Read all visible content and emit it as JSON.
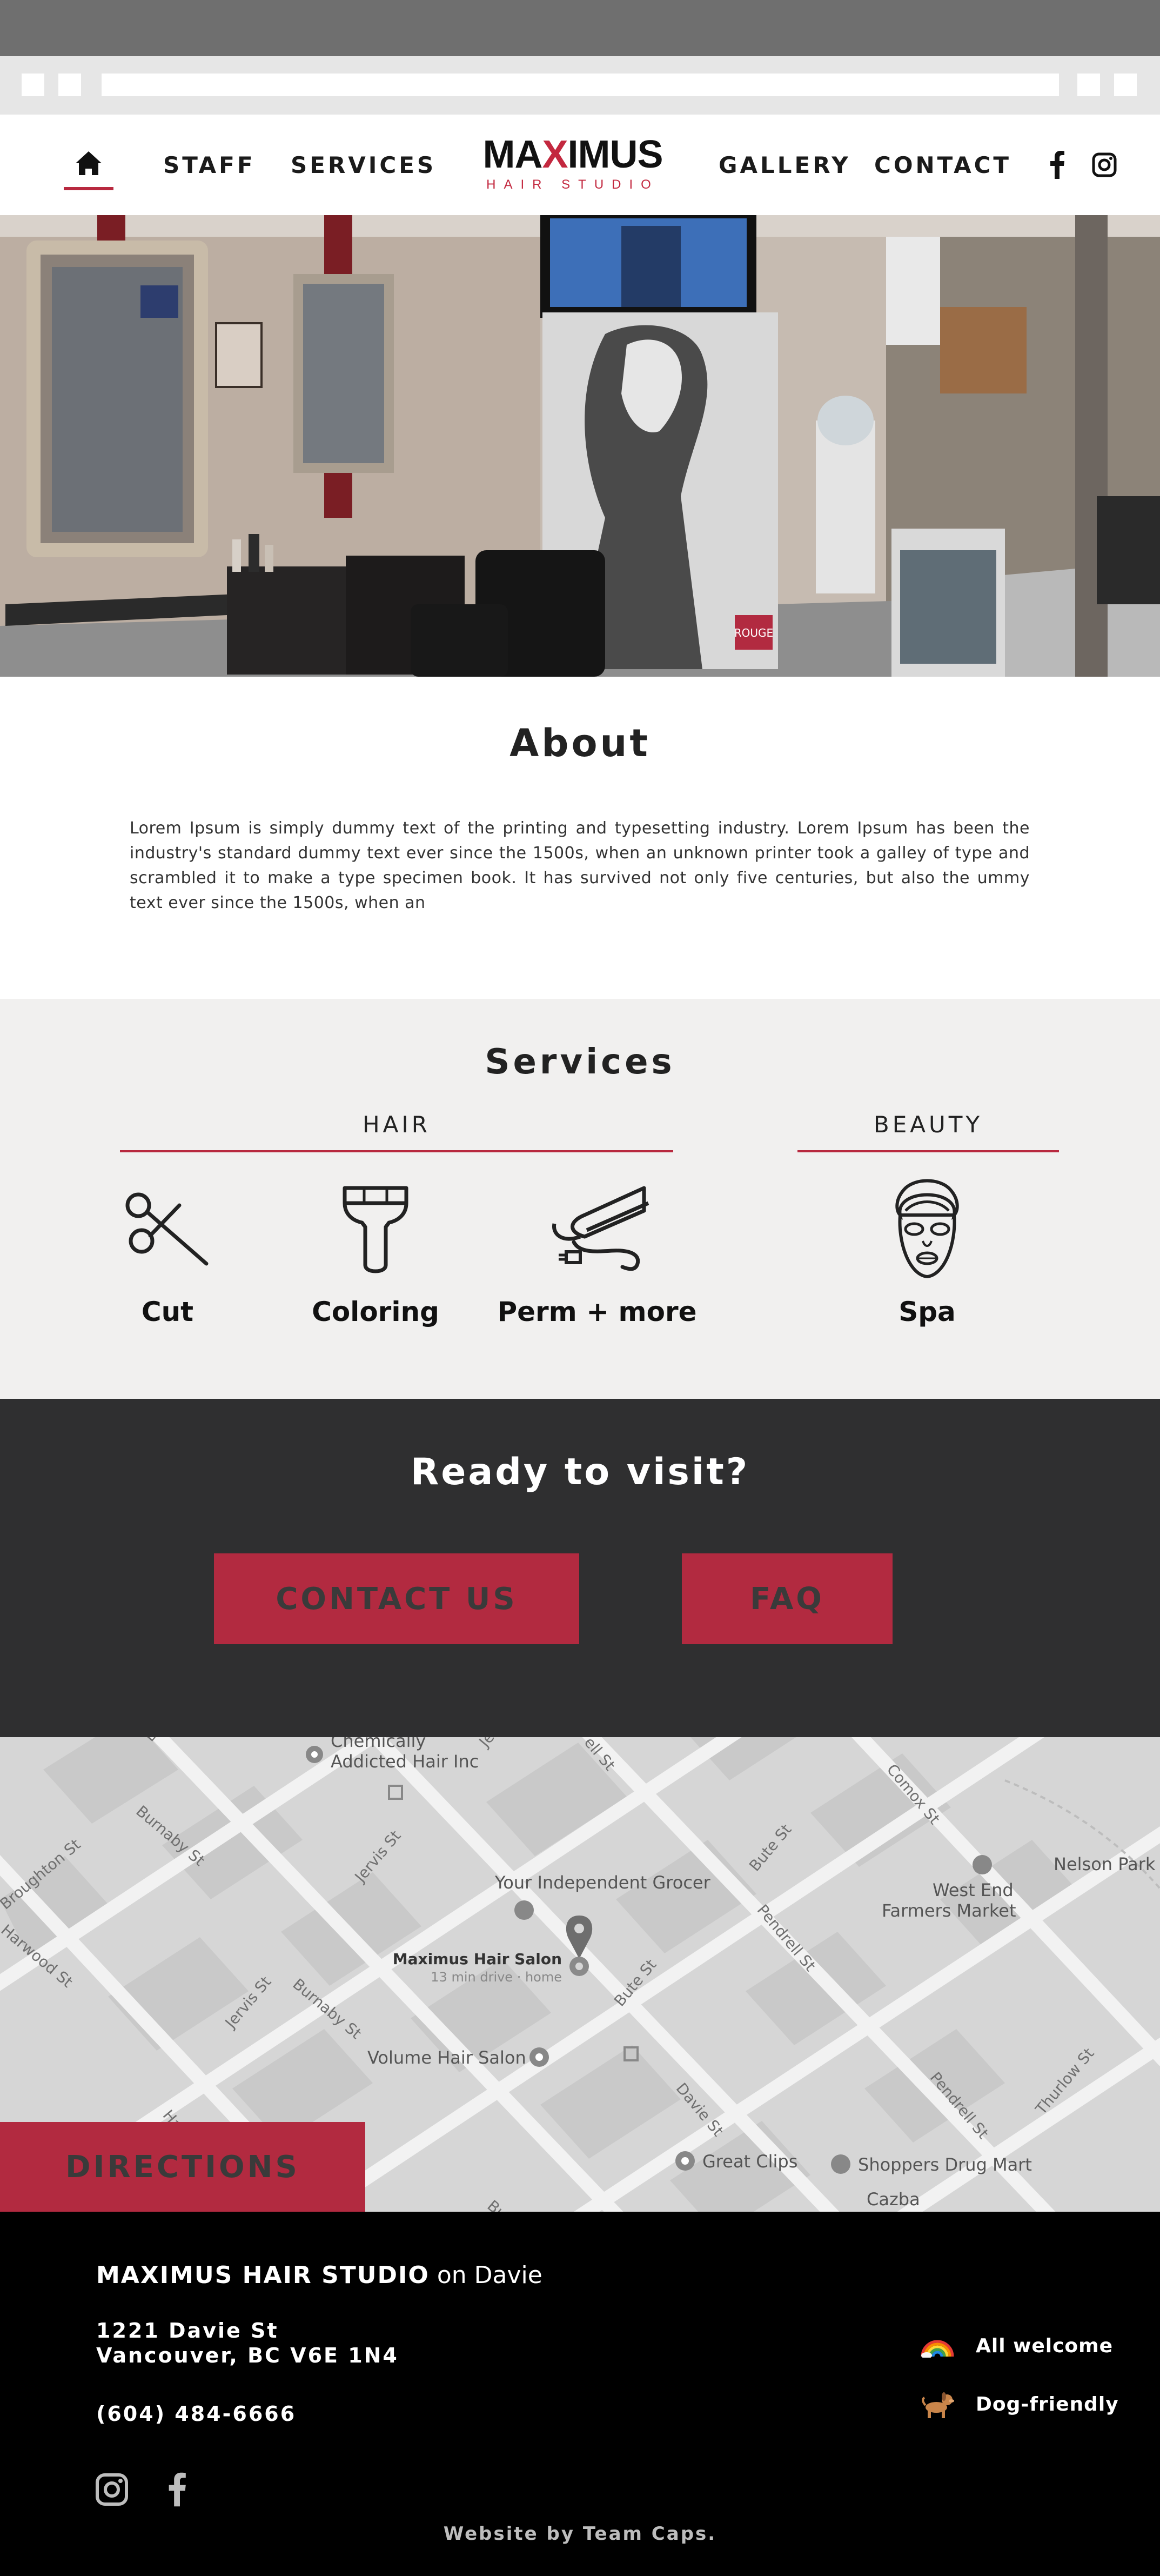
{
  "nav": {
    "items": [
      "STAFF",
      "SERVICES",
      "GALLERY",
      "CONTACT"
    ],
    "logo_main_left": "MA",
    "logo_main_x": "X",
    "logo_main_right": "IMUS",
    "logo_sub": "HAIR STUDIO",
    "icons": [
      "home-icon",
      "facebook-icon",
      "instagram-icon"
    ]
  },
  "hero": {
    "poster_text": "ROUGE"
  },
  "about": {
    "title": "About",
    "body": "Lorem Ipsum is simply dummy text of the printing and typesetting industry. Lorem Ipsum has been the industry's standard dummy text ever since the 1500s, when an unknown printer took a galley of type and scrambled it to make a type specimen book. It has survived not only five centuries, but also the ummy text ever since the 1500s, when an"
  },
  "services": {
    "title": "Services",
    "categories": {
      "hair": "HAIR",
      "beauty": "BEAUTY"
    },
    "items": [
      {
        "name": "Cut",
        "icon": "scissors-icon"
      },
      {
        "name": "Coloring",
        "icon": "paint-brush-icon"
      },
      {
        "name": "Perm + more",
        "icon": "hair-straightener-icon"
      },
      {
        "name": "Spa",
        "icon": "face-mask-icon"
      }
    ]
  },
  "cta": {
    "title": "Ready to visit?",
    "contact_label": "CONTACT US",
    "faq_label": "FAQ"
  },
  "map": {
    "places": {
      "chemically": "Chemically",
      "addicted": "Addicted Hair Inc",
      "grocer": "Your Independent Grocer",
      "westend1": "West End",
      "westend2": "Farmers Market",
      "nelson": "Nelson Park",
      "salon": "Maximus Hair Salon",
      "salon_sub": "13 min drive · home",
      "volume": "Volume Hair Salon",
      "clips": "Great Clips",
      "shoppers": "Shoppers Drug Mart",
      "cazba": "Cazba"
    },
    "streets": {
      "burnaby1": "Burnaby St",
      "burnaby2": "Burnaby St",
      "burnaby3": "Burnab",
      "broughton": "Broughton St",
      "harwood": "Harwood St",
      "jervis1": "Jervis St",
      "jervis2": "Jervis St",
      "bute1": "Bute St",
      "bute2": "Bute St",
      "pendrell1": "Pendrell St",
      "pendrell2": "Pendrell St",
      "comox": "Comox St",
      "davie": "Davie St",
      "thurlow": "Thurlow St",
      "hell": "ell St",
      "ha": "Ha",
      "je": "Je",
      "b": "B"
    },
    "directions_label": "DIRECTIONS"
  },
  "footer": {
    "brand": "MAXIMUS HAIR STUDIO",
    "brand_suffix": " on Davie",
    "address_line1": "1221 Davie St",
    "address_line2": "Vancouver, BC V6E 1N4",
    "phone": "(604) 484-6666",
    "features": [
      {
        "label": "All welcome",
        "icon": "rainbow-icon"
      },
      {
        "label": "Dog-friendly",
        "icon": "dog-icon"
      }
    ],
    "credit": "Website by Team Caps."
  },
  "colors": {
    "accent": "#b22a40",
    "dark": "#2f2f30",
    "footer": "#000000",
    "services_bg": "#f1f0ef"
  }
}
